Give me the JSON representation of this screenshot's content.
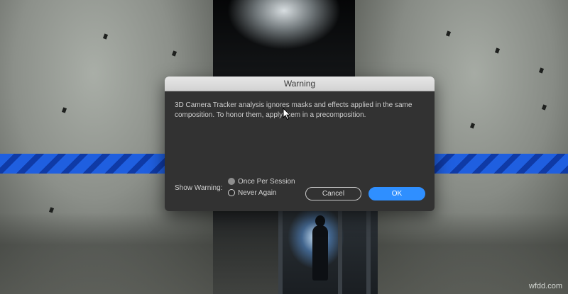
{
  "dialog": {
    "title": "Warning",
    "message": "3D Camera Tracker analysis ignores masks and effects applied in the same composition. To honor them, apply them in a precomposition.",
    "show_warning_label": "Show Warning:",
    "options": [
      {
        "label": "Once Per Session",
        "selected": true
      },
      {
        "label": "Never Again",
        "selected": false
      }
    ],
    "cancel_label": "Cancel",
    "ok_label": "OK"
  },
  "watermark": "wfdd.com",
  "colors": {
    "accent": "#2f8fff",
    "stripe": "#1f5fe0",
    "dialog_bg": "#323232"
  }
}
